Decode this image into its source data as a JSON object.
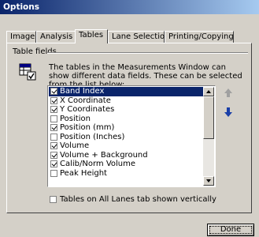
{
  "window": {
    "title": "Options"
  },
  "tabs": [
    {
      "label": "Image",
      "active": false
    },
    {
      "label": "Analysis",
      "active": false
    },
    {
      "label": "Tables",
      "active": true
    },
    {
      "label": "Lane Selection",
      "active": false
    },
    {
      "label": "Printing/Copying",
      "active": false
    }
  ],
  "group": {
    "label": "Table fields",
    "description": "The tables in the Measurements Window can show different data fields. These can be selected from the list below:",
    "icon": "table-fields-icon"
  },
  "fields": [
    {
      "label": "Band Index",
      "checked": true,
      "selected": true
    },
    {
      "label": "X Coordinate",
      "checked": true,
      "selected": false
    },
    {
      "label": "Y Coordinates",
      "checked": true,
      "selected": false
    },
    {
      "label": "Position",
      "checked": false,
      "selected": false
    },
    {
      "label": "Position (mm)",
      "checked": true,
      "selected": false
    },
    {
      "label": "Position (Inches)",
      "checked": false,
      "selected": false
    },
    {
      "label": "Volume",
      "checked": true,
      "selected": false
    },
    {
      "label": "Volume + Background",
      "checked": true,
      "selected": false
    },
    {
      "label": "Calib/Norm Volume",
      "checked": true,
      "selected": false
    },
    {
      "label": "Peak Height",
      "checked": false,
      "selected": false
    }
  ],
  "move_buttons": {
    "up_icon": "arrow-up-icon",
    "down_icon": "arrow-down-icon"
  },
  "vertical_option": {
    "label": "Tables on All Lanes tab shown vertically",
    "checked": false
  },
  "done_button": {
    "label": "Done"
  },
  "colors": {
    "selection": "#0a246a",
    "title_start": "#0a246a",
    "title_end": "#a6caf0",
    "dialog": "#d4d0c8"
  }
}
